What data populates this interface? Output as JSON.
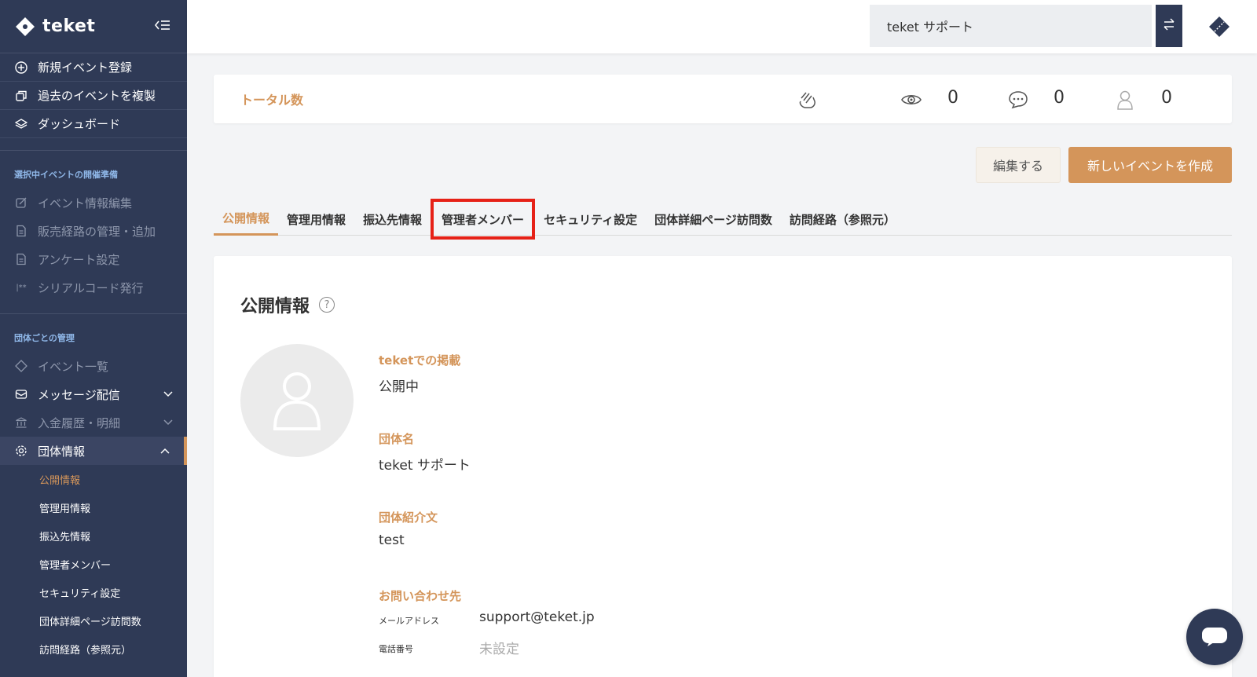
{
  "brand": {
    "name": "teket"
  },
  "sidebar": {
    "top_items": [
      {
        "label": "新規イベント登録",
        "icon": "plus-circle-icon"
      },
      {
        "label": "過去のイベントを複製",
        "icon": "copy-icon"
      },
      {
        "label": "ダッシュボード",
        "icon": "layers-icon"
      }
    ],
    "section1": "選択中イベントの開催準備",
    "event_items": [
      {
        "label": "イベント情報編集",
        "icon": "edit-icon"
      },
      {
        "label": "販売経路の管理・追加",
        "icon": "document-icon"
      },
      {
        "label": "アンケート設定",
        "icon": "document-icon"
      },
      {
        "label": "シリアルコード発行",
        "icon": "serial-icon"
      }
    ],
    "section2": "団体ごとの管理",
    "org_items": [
      {
        "label": "イベント一覧",
        "icon": "ticket-icon"
      },
      {
        "label": "メッセージ配信",
        "icon": "mail-icon"
      },
      {
        "label": "入金履歴・明細",
        "icon": "bank-icon"
      },
      {
        "label": "団体情報",
        "icon": "gear-icon"
      }
    ],
    "sub_items": [
      {
        "label": "公開情報"
      },
      {
        "label": "管理用情報"
      },
      {
        "label": "振込先情報"
      },
      {
        "label": "管理者メンバー"
      },
      {
        "label": "セキュリティ設定"
      },
      {
        "label": "団体詳細ページ訪問数"
      },
      {
        "label": "訪問経路（参照元）"
      }
    ]
  },
  "topbar": {
    "org_name": "teket サポート"
  },
  "totals": {
    "title": "トータル数",
    "views": "0",
    "comments": "0",
    "users": "0"
  },
  "actions": {
    "edit": "編集する",
    "new_event": "新しいイベントを作成"
  },
  "tabs": [
    "公開情報",
    "管理用情報",
    "振込先情報",
    "管理者メンバー",
    "セキュリティ設定",
    "団体詳細ページ訪問数",
    "訪問経路（参照元）"
  ],
  "panel": {
    "title": "公開情報",
    "help": "?",
    "listing_label": "teketでの掲載",
    "listing_value": "公開中",
    "org_name_label": "団体名",
    "org_name_value": "teket サポート",
    "intro_label": "団体紹介文",
    "intro_value": "test",
    "contact_label": "お問い合わせ先",
    "email_label": "メールアドレス",
    "email_value": "support@teket.jp",
    "phone_label": "電話番号",
    "phone_value": "未設定"
  },
  "colors": {
    "sidebar": "#2f3a56",
    "accent": "#d4955a",
    "highlight": "#e62117"
  }
}
